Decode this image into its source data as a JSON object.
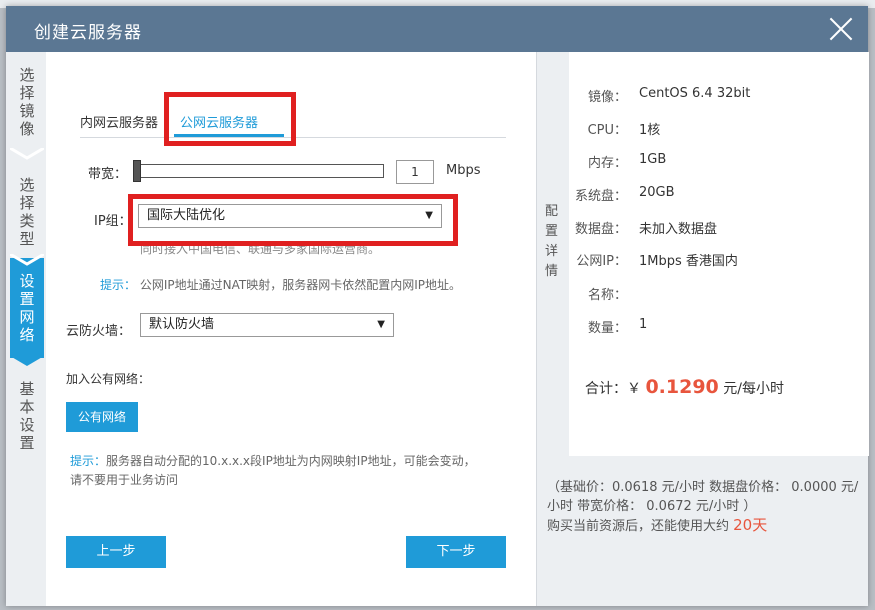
{
  "dialog": {
    "title": "创建云服务器"
  },
  "steps": [
    {
      "label": [
        "选",
        "择",
        "镜",
        "像"
      ]
    },
    {
      "label": [
        "选",
        "择",
        "类",
        "型"
      ]
    },
    {
      "label": [
        "设",
        "置",
        "网",
        "络"
      ]
    },
    {
      "label": [
        "基",
        "本",
        "设",
        "置"
      ]
    }
  ],
  "tabs": {
    "intranet": "内网云服务器",
    "public": "公网云服务器"
  },
  "form": {
    "bandwidth_label": "带宽：",
    "bandwidth_value": "1",
    "bandwidth_unit": "Mbps",
    "ip_group_label": "IP组：",
    "ip_group_value": "国际大陆优化",
    "ip_group_note": "同时接入中国电信、联通与多家国际运营商。",
    "tip1_key": "提示：",
    "tip1_text": "公网IP地址通过NAT映射，服务器网卡依然配置内网IP地址。",
    "firewall_label": "云防火墙：",
    "firewall_value": "默认防火墙",
    "join_public_label": "加入公有网络：",
    "public_net_button": "公有网络",
    "tip2_key": "提示：",
    "tip2_line1": "服务器自动分配的10.x.x.x段IP地址为内网映射IP地址，可能会变动，",
    "tip2_line2": "请不要用于业务访问",
    "prev_button": "上一步",
    "next_button": "下一步"
  },
  "summary": {
    "vertical_label": [
      "配",
      "置",
      "详",
      "情"
    ],
    "rows": [
      {
        "k": "镜像：",
        "v": "CentOS 6.4 32bit"
      },
      {
        "k": "CPU：",
        "v": "1核"
      },
      {
        "k": "内存：",
        "v": "1GB"
      },
      {
        "k": "系统盘：",
        "v": "20GB"
      },
      {
        "k": "数据盘：",
        "v": "未加入数据盘"
      },
      {
        "k": "公网IP：",
        "v": "1Mbps 香港国内"
      },
      {
        "k": "名称：",
        "v": ""
      },
      {
        "k": "数量：",
        "v": "1"
      }
    ],
    "total_label": "合计：￥",
    "total_value": "0.1290",
    "total_unit": "元/每小时",
    "price_line1": "（基础价：0.0618 元/小时  数据盘价格： 0.0000 元/",
    "price_line2": "小时  带宽价格： 0.0672 元/小时  ）",
    "price_line3": "购买当前资源后，还能使用大约 ",
    "days_left": "20天"
  },
  "colors": {
    "accent": "#1f9bd8",
    "titlebar": "#5b7793",
    "price": "#e8553d",
    "highlight": "#e02020"
  }
}
